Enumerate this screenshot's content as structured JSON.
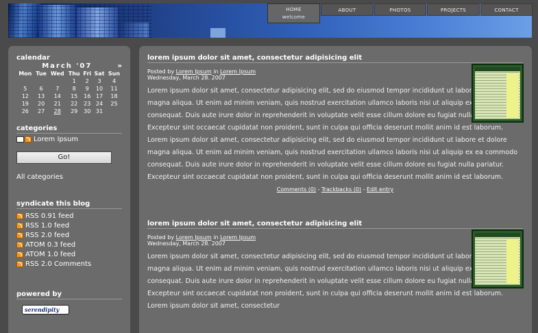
{
  "nav": {
    "items": [
      {
        "label": "HOME",
        "sub": "welcome"
      },
      {
        "label": "ABOUT"
      },
      {
        "label": "PHOTOS"
      },
      {
        "label": "PROJECTS"
      },
      {
        "label": "CONTACT"
      }
    ]
  },
  "sidebar": {
    "calendar": {
      "title": "calendar",
      "month": "March '07",
      "next": "»",
      "days": [
        "Mon",
        "Tue",
        "Wed",
        "Thu",
        "Fri",
        "Sat",
        "Sun"
      ],
      "weeks": [
        [
          "",
          "",
          "",
          "1",
          "2",
          "3",
          "4"
        ],
        [
          "5",
          "6",
          "7",
          "8",
          "9",
          "10",
          "11"
        ],
        [
          "12",
          "13",
          "14",
          "15",
          "16",
          "17",
          "18"
        ],
        [
          "19",
          "20",
          "21",
          "22",
          "23",
          "24",
          "25"
        ],
        [
          "26",
          "27",
          "28",
          "29",
          "30",
          "31",
          ""
        ]
      ],
      "linked_day": "28"
    },
    "categories": {
      "title": "categories",
      "item": "Lorem Ipsum",
      "go_label": "Go!",
      "all_label": "All categories"
    },
    "syndicate": {
      "title": "syndicate this blog",
      "feeds": [
        "RSS 0.91 feed",
        "RSS 1.0 feed",
        "RSS 2.0 feed",
        "ATOM 0.3 feed",
        "ATOM 1.0 feed",
        "RSS 2.0 Comments"
      ]
    },
    "powered": {
      "title": "powered by",
      "badge": "serendipity"
    }
  },
  "entries": [
    {
      "title": "lorem ipsum dolor sit amet, consectetur adipisicing elit",
      "posted_by_prefix": "Posted by",
      "author": "Lorem Ipsum",
      "in_word": "in",
      "category": "Lorem Ipsum",
      "date": "Wednesday, March 28. 2007",
      "body": "Lorem ipsum dolor sit amet, consectetur adipisicing elit, sed do eiusmod tempor incididunt ut labore et dolore magna aliqua. Ut enim ad minim veniam, quis nostrud exercitation ullamco laboris nisi ut aliquip ex ea commodo consequat. Duis aute irure dolor in reprehenderit in voluptate velit esse cillum dolore eu fugiat nulla pariatur. Excepteur sint occaecat cupidatat non proident, sunt in culpa qui officia deserunt mollit anim id est laborum. Lorem ipsum dolor sit amet, consectetur adipisicing elit, sed do eiusmod tempor incididunt ut labore et dolore magna aliqua. Ut enim ad minim veniam, quis nostrud exercitation ullamco laboris nisi ut aliquip ex ea commodo consequat. Duis aute irure dolor in reprehenderit in voluptate velit esse cillum dolore eu fugiat nulla pariatur. Excepteur sint occaecat cupidatat non proident, sunt in culpa qui officia deserunt mollit anim id est laborum.",
      "comments": "Comments (0)",
      "trackbacks": "Trackbacks (0)",
      "edit": "Edit entry"
    },
    {
      "title": "lorem ipsum dolor sit amet, consectetur adipisicing elit",
      "posted_by_prefix": "Posted by",
      "author": "Lorem Ipsum",
      "in_word": "in",
      "category": "Lorem Ipsum",
      "date": "Wednesday, March 28. 2007",
      "body": "Lorem ipsum dolor sit amet, consectetur adipisicing elit, sed do eiusmod tempor incididunt ut labore et dolore magna aliqua. Ut enim ad minim veniam, quis nostrud exercitation ullamco laboris nisi ut aliquip ex ea commodo consequat. Duis aute irure dolor in reprehenderit in voluptate velit esse cillum dolore eu fugiat nulla pariatur. Excepteur sint occaecat cupidatat non proident, sunt in culpa qui officia deserunt mollit anim id est laborum. Lorem ipsum dolor sit amet, consectetur"
    }
  ],
  "footer_separator": "-"
}
